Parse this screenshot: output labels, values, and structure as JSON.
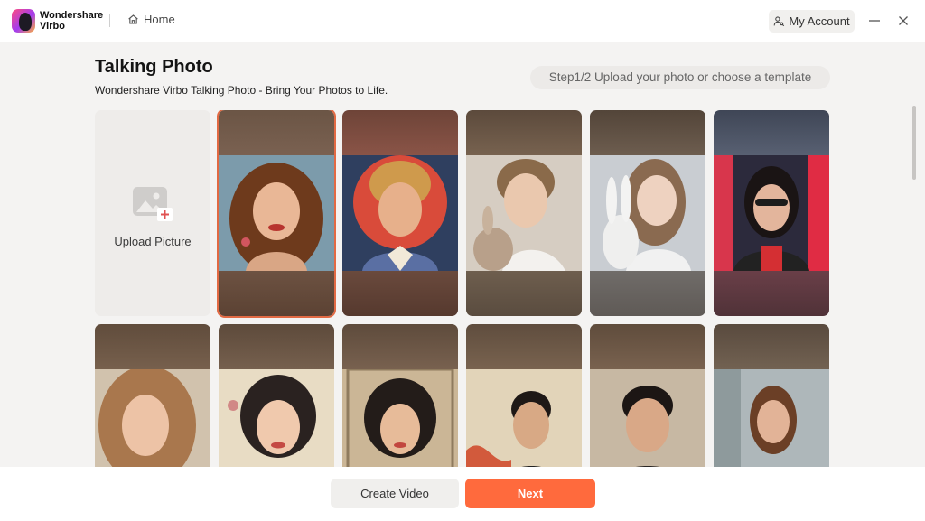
{
  "app": {
    "logo_text_line1": "Wondershare",
    "logo_text_line2": "Virbo",
    "home_label": "Home",
    "account_label": "My Account"
  },
  "page": {
    "title": "Talking Photo",
    "subtitle": "Wondershare Virbo Talking Photo - Bring Your Photos to Life.",
    "step": "Step1/2 Upload your photo or choose a template"
  },
  "grid": {
    "upload_label": "Upload Picture",
    "selected_index": 0
  },
  "footer": {
    "create_label": "Create Video",
    "next_label": "Next"
  },
  "colors": {
    "accent": "#ff6a3d",
    "selected_border": "#e26a44"
  },
  "icons": {
    "logo": "virbo-logo-icon",
    "home": "home-icon",
    "account": "user-key-icon",
    "upload": "image-add-icon",
    "minimize": "minimize-icon",
    "close": "close-icon"
  }
}
